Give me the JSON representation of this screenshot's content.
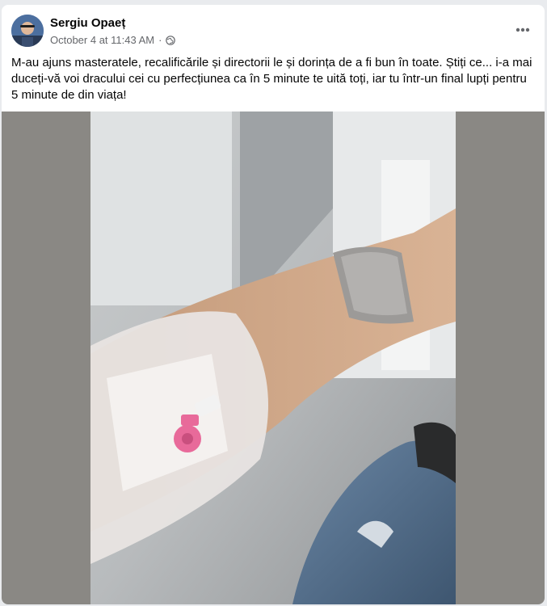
{
  "post": {
    "author": "Sergiu Opaeț",
    "timestamp": "October 4 at 11:43 AM",
    "separator": "·",
    "privacy_icon": "globe-icon",
    "more_icon": "more-horiz-icon",
    "text": "M-au ajuns masteratele, recalificările și directorii le și dorința de a fi bun în toate. Știți ce... i-a mai duceți-vă voi dracului cei cu perfecțiunea ca în 5 minute te uită toți, iar tu într-un final lupți pentru 5 minute de din viața!",
    "image": "photo-arm-with-iv-cannula"
  },
  "colors": {
    "background": "#e9ebee",
    "card": "#ffffff",
    "name": "#050505",
    "secondary": "#65676b",
    "media_bg": "#8a8884",
    "cannula_pink": "#e86a9a"
  }
}
